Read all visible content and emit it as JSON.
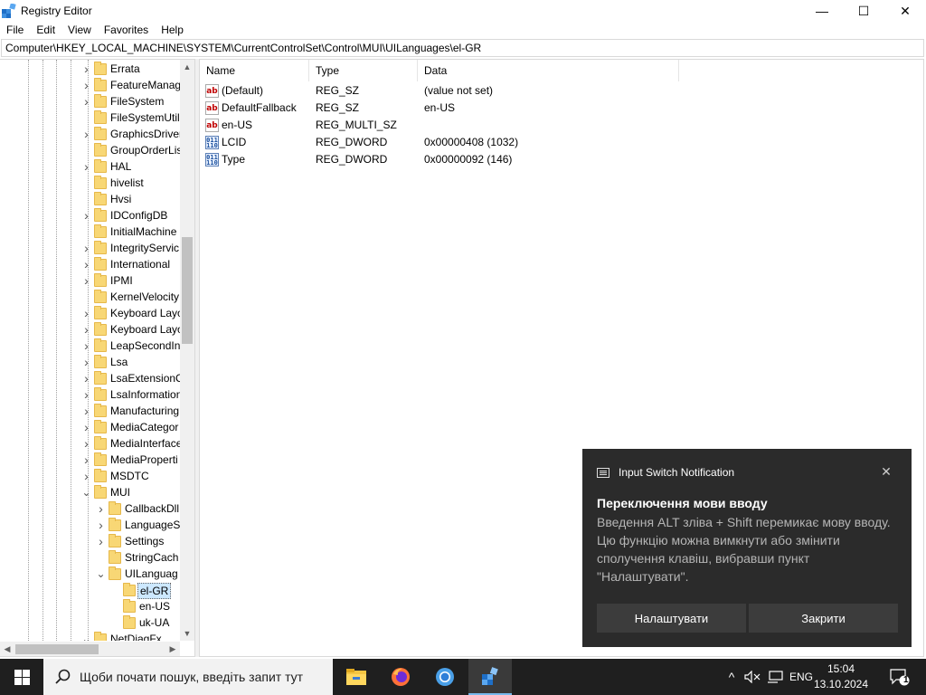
{
  "window": {
    "title": "Registry Editor",
    "minimize": "—",
    "maximize": "☐",
    "close": "✕"
  },
  "menu": [
    "File",
    "Edit",
    "View",
    "Favorites",
    "Help"
  ],
  "address": "Computer\\HKEY_LOCAL_MACHINE\\SYSTEM\\CurrentControlSet\\Control\\MUI\\UILanguages\\el-GR",
  "tree": {
    "items": [
      {
        "label": "Errata",
        "level": 0,
        "expander": "›"
      },
      {
        "label": "FeatureManag",
        "level": 0,
        "expander": "›"
      },
      {
        "label": "FileSystem",
        "level": 0,
        "expander": "›"
      },
      {
        "label": "FileSystemUtil",
        "level": 0,
        "expander": ""
      },
      {
        "label": "GraphicsDriver",
        "level": 0,
        "expander": "›"
      },
      {
        "label": "GroupOrderLis",
        "level": 0,
        "expander": ""
      },
      {
        "label": "HAL",
        "level": 0,
        "expander": "›"
      },
      {
        "label": "hivelist",
        "level": 0,
        "expander": ""
      },
      {
        "label": "Hvsi",
        "level": 0,
        "expander": ""
      },
      {
        "label": "IDConfigDB",
        "level": 0,
        "expander": "›"
      },
      {
        "label": "InitialMachine",
        "level": 0,
        "expander": ""
      },
      {
        "label": "IntegrityServic",
        "level": 0,
        "expander": "›"
      },
      {
        "label": "International",
        "level": 0,
        "expander": "›"
      },
      {
        "label": "IPMI",
        "level": 0,
        "expander": "›"
      },
      {
        "label": "KernelVelocity",
        "level": 0,
        "expander": ""
      },
      {
        "label": "Keyboard Layo",
        "level": 0,
        "expander": "›"
      },
      {
        "label": "Keyboard Layo",
        "level": 0,
        "expander": "›"
      },
      {
        "label": "LeapSecondIn",
        "level": 0,
        "expander": "›"
      },
      {
        "label": "Lsa",
        "level": 0,
        "expander": "›"
      },
      {
        "label": "LsaExtensionC",
        "level": 0,
        "expander": "›"
      },
      {
        "label": "LsaInformation",
        "level": 0,
        "expander": "›"
      },
      {
        "label": "Manufacturing",
        "level": 0,
        "expander": "›"
      },
      {
        "label": "MediaCategor",
        "level": 0,
        "expander": "›"
      },
      {
        "label": "MediaInterface",
        "level": 0,
        "expander": "›"
      },
      {
        "label": "MediaProperti",
        "level": 0,
        "expander": "›"
      },
      {
        "label": "MSDTC",
        "level": 0,
        "expander": "›"
      },
      {
        "label": "MUI",
        "level": 0,
        "expander": "⌄"
      },
      {
        "label": "CallbackDll",
        "level": 1,
        "expander": "›"
      },
      {
        "label": "LanguageS",
        "level": 1,
        "expander": "›"
      },
      {
        "label": "Settings",
        "level": 1,
        "expander": "›"
      },
      {
        "label": "StringCach",
        "level": 1,
        "expander": ""
      },
      {
        "label": "UILanguag",
        "level": 1,
        "expander": "⌄"
      },
      {
        "label": "el-GR",
        "level": 2,
        "expander": "",
        "selected": true
      },
      {
        "label": "en-US",
        "level": 2,
        "expander": ""
      },
      {
        "label": "uk-UA",
        "level": 2,
        "expander": ""
      },
      {
        "label": "NetDiagFx",
        "level": 0,
        "expander": "⌄"
      }
    ]
  },
  "list": {
    "columns": [
      "Name",
      "Type",
      "Data"
    ],
    "rows": [
      {
        "icon": "ab",
        "name": "(Default)",
        "type": "REG_SZ",
        "data": "(value not set)"
      },
      {
        "icon": "ab",
        "name": "DefaultFallback",
        "type": "REG_SZ",
        "data": "en-US"
      },
      {
        "icon": "ab",
        "name": "en-US",
        "type": "REG_MULTI_SZ",
        "data": ""
      },
      {
        "icon": "bin",
        "name": "LCID",
        "type": "REG_DWORD",
        "data": "0x00000408 (1032)"
      },
      {
        "icon": "bin",
        "name": "Type",
        "type": "REG_DWORD",
        "data": "0x00000092 (146)"
      }
    ]
  },
  "notification": {
    "app": "Input Switch Notification",
    "close": "✕",
    "title": "Переключення мови вводу",
    "body": "Введення ALT зліва + Shift перемикає мову вводу. Цю функцію можна вимкнути або змінити сполучення клавіш, вибравши пункт \"Налаштувати\".",
    "buttons": [
      "Налаштувати",
      "Закрити"
    ]
  },
  "taskbar": {
    "search_placeholder": "Щоби почати пошук, введіть запит тут",
    "apps": [
      "file-explorer-icon",
      "firefox-icon",
      "chrome-icon",
      "registry-editor-icon"
    ],
    "language": "ENG",
    "time": "15:04",
    "date": "13.10.2024",
    "notification_count": "1",
    "tray_chevron": "^"
  },
  "colors": {
    "selection": "#cce8ff",
    "taskbar": "#1f1f1f",
    "toast": "#2b2b2b",
    "folder": "#f8d775"
  }
}
